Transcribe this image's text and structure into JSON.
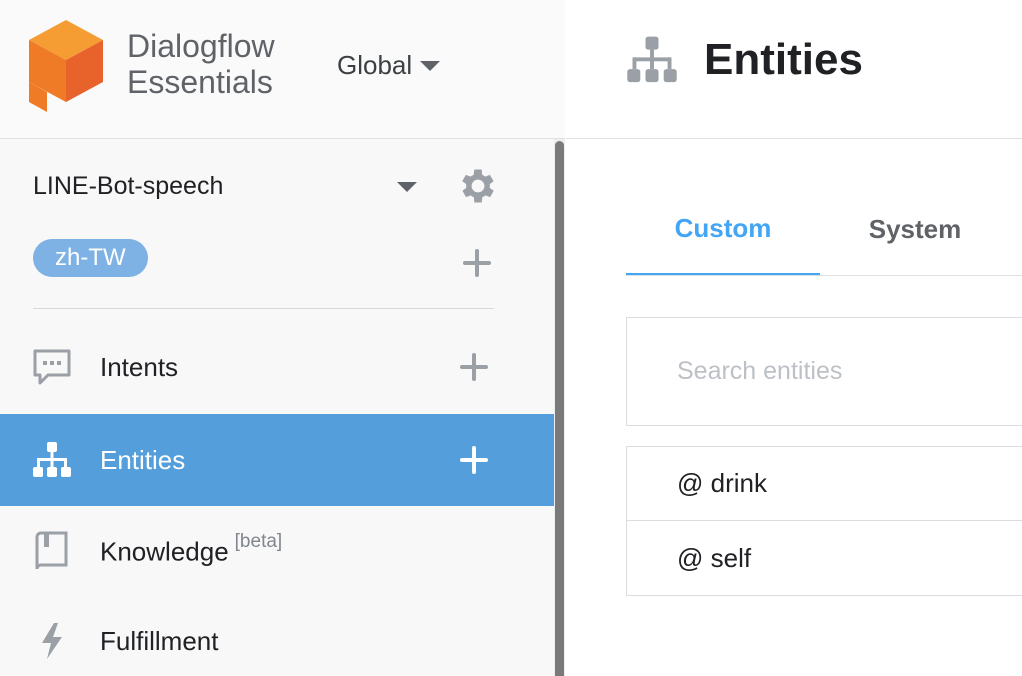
{
  "brand": {
    "name_line1": "Dialogflow",
    "name_line2": "Essentials",
    "logo_colors": {
      "top": "#f59c33",
      "left": "#ef7b27",
      "right": "#e8632b"
    }
  },
  "region": {
    "label": "Global"
  },
  "agent": {
    "name": "LINE-Bot-speech"
  },
  "language": {
    "chip_label": "zh-TW",
    "chip_color": "#7eb1e4"
  },
  "nav": {
    "items": [
      {
        "label": "Intents",
        "icon": "chat-bubble-icon",
        "has_add": true
      },
      {
        "label": "Entities",
        "icon": "sitemap-icon",
        "has_add": true,
        "active": true
      },
      {
        "label": "Knowledge",
        "badge": "[beta]",
        "icon": "book-icon",
        "has_add": false
      },
      {
        "label": "Fulfillment",
        "icon": "lightning-icon",
        "has_add": false
      }
    ],
    "active_color": "#549fdb"
  },
  "page": {
    "title": "Entities",
    "icon": "sitemap-icon"
  },
  "tabs": [
    {
      "label": "Custom",
      "selected": true
    },
    {
      "label": "System",
      "selected": false
    }
  ],
  "search": {
    "placeholder": "Search entities",
    "value": ""
  },
  "entities": [
    {
      "name": "@ drink"
    },
    {
      "name": "@ self"
    }
  ],
  "accent_color": "#42a5f5"
}
